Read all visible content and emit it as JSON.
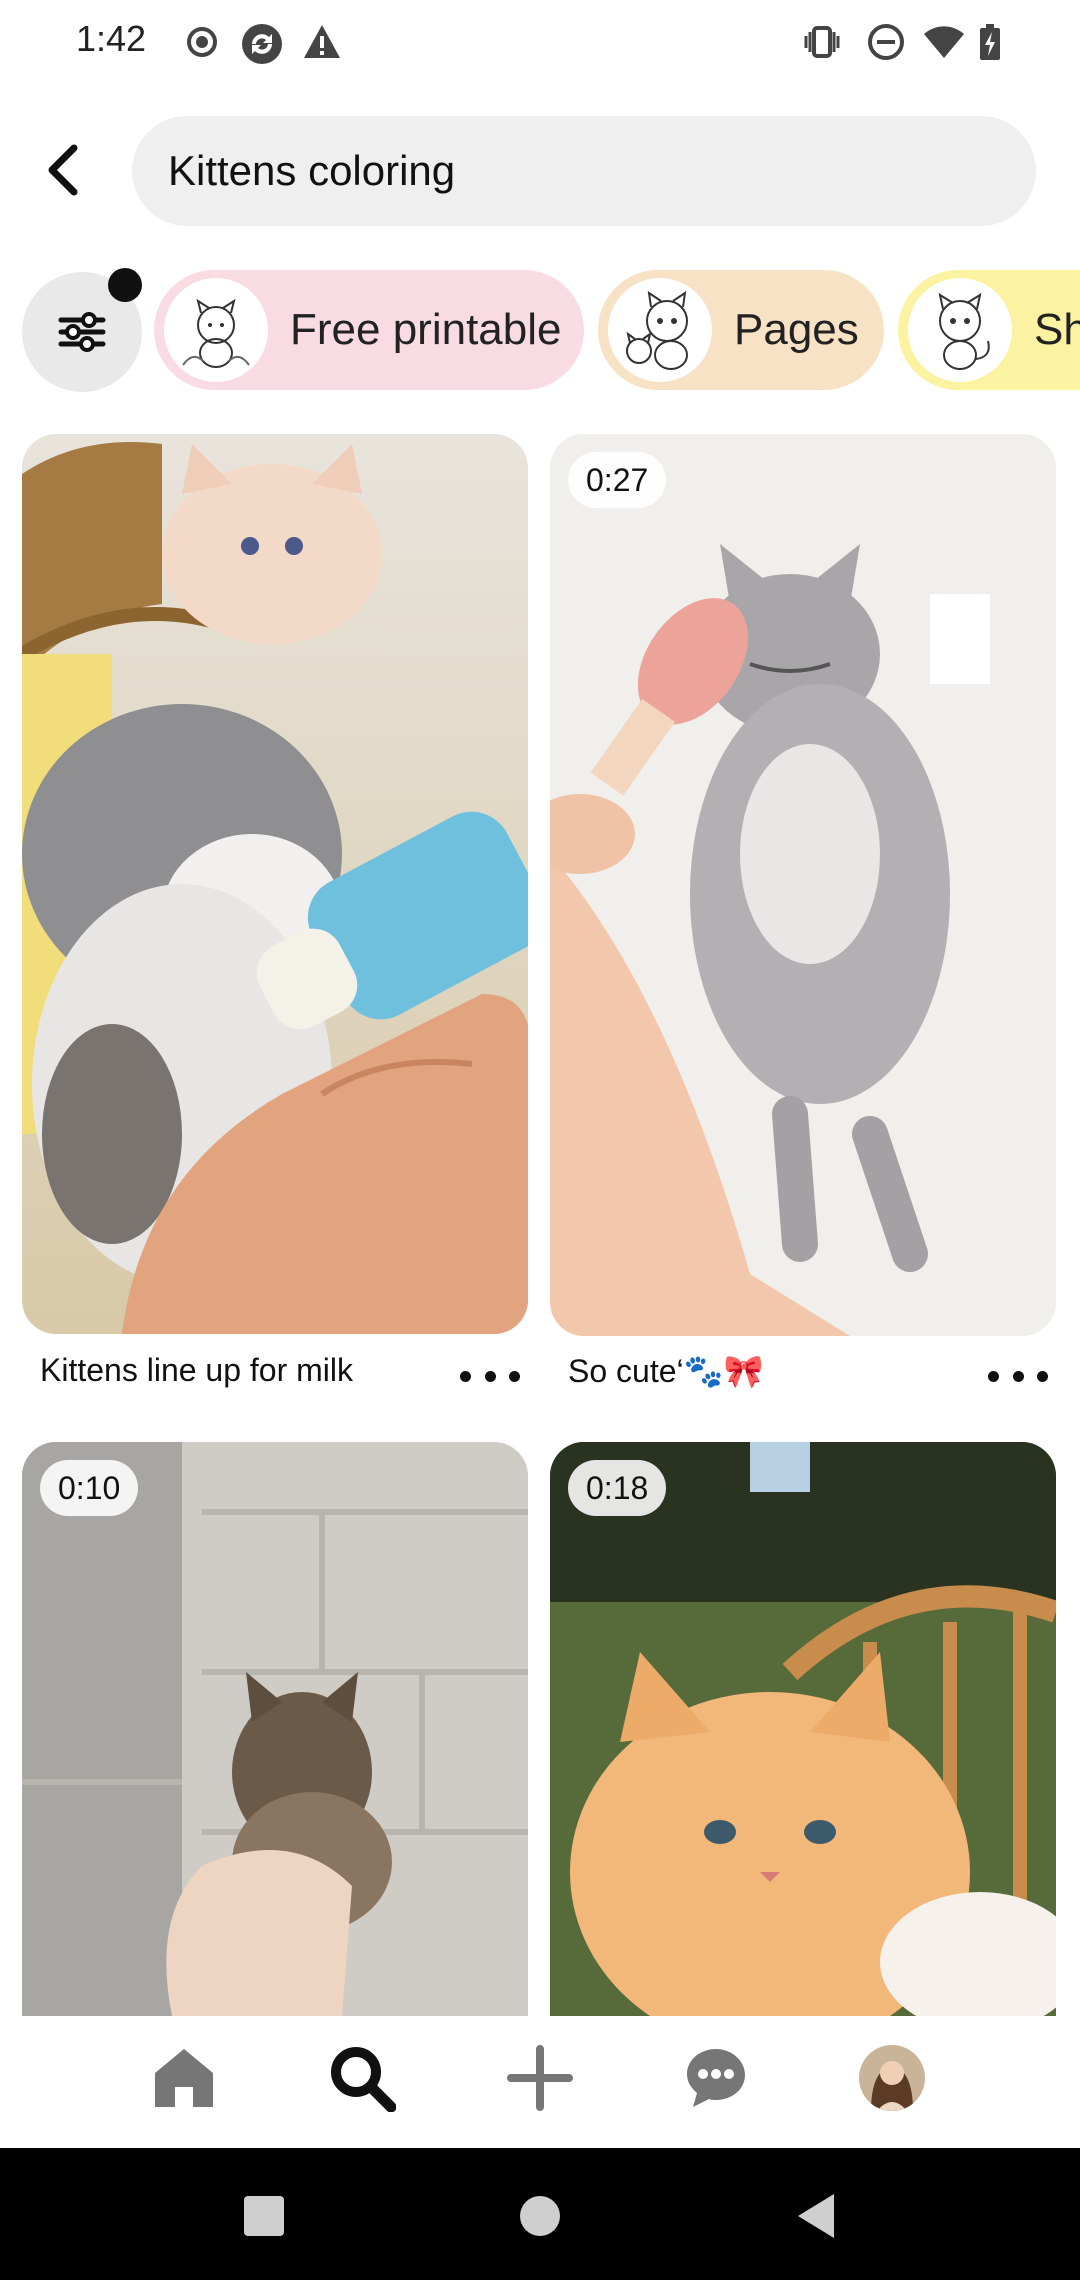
{
  "status_bar": {
    "time": "1:42",
    "left_icons": [
      "record-icon",
      "sync-icon",
      "warning-icon"
    ],
    "right_icons": [
      "vibrate-icon",
      "do-not-disturb-icon",
      "wifi-icon",
      "battery-charging-icon"
    ]
  },
  "header": {
    "back_icon": "chevron-left-icon",
    "search_query": "Kittens coloring"
  },
  "filter_chips": {
    "filter_icon": "sliders-icon",
    "filter_active": true,
    "chips": [
      {
        "label": "Free printable",
        "color": "#f8dbe3"
      },
      {
        "label": "Pages",
        "color": "#f8e2c6"
      },
      {
        "label": "Sh",
        "color": "#fbf3a2"
      }
    ]
  },
  "pins": [
    {
      "caption": "Kittens line up for milk",
      "duration": ""
    },
    {
      "caption": "So cute‘🐾🎀",
      "duration": "0:27"
    },
    {
      "caption": "",
      "duration": "0:10"
    },
    {
      "caption": "",
      "duration": "0:18"
    }
  ],
  "bottom_nav": {
    "items": [
      "home-icon",
      "search-icon",
      "create-icon",
      "messages-icon",
      "profile-avatar"
    ],
    "active": "search-icon"
  },
  "system_nav": [
    "recents-icon",
    "home-circle-icon",
    "back-triangle-icon"
  ]
}
